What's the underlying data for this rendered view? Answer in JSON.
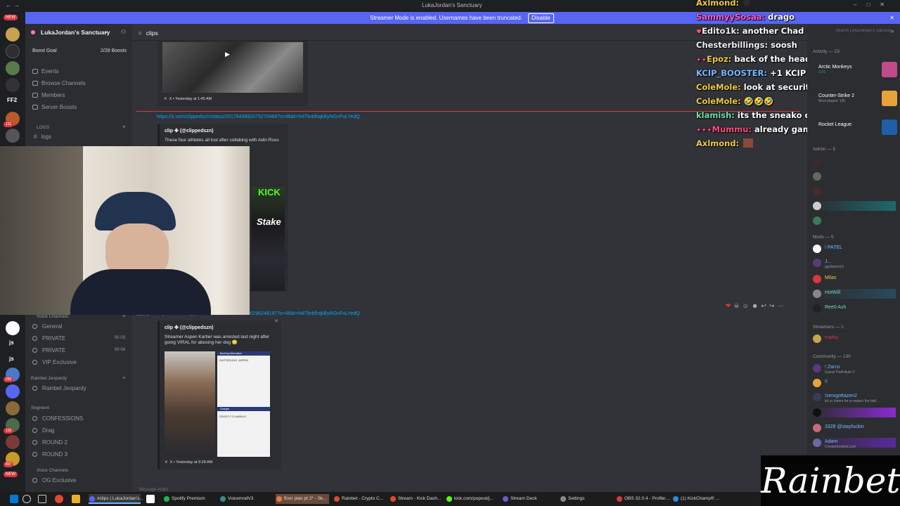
{
  "window": {
    "title": "LukaJordan's Sanctuary",
    "nav_back": "←",
    "nav_forward": "→"
  },
  "banner": {
    "text": "Streamer Mode is enabled. Usernames have been truncated.",
    "button": "Disable"
  },
  "rail": {
    "badges": [
      "NEW",
      "NEW"
    ],
    "ff2": "FF2",
    "counts": [
      "131",
      "289",
      "120",
      "897"
    ],
    "js1": "js",
    "js2": "js"
  },
  "sidebar": {
    "server_name": "LukaJordan's Sanctuary",
    "boost_goal": "Boost Goal",
    "boost_count": "2/28 Boosts",
    "nav": [
      "Events",
      "Browse Channels",
      "Members",
      "Server Boosts"
    ],
    "categories": {
      "logs": "LOGS",
      "voice": "Voice Channels",
      "rainbet": "Rainbet Jeopardy",
      "segment": "Segment",
      "voice2": "Voice Channels"
    },
    "channels_top": [
      "logs"
    ],
    "voice_channels": [
      {
        "name": "General",
        "count_a": "",
        "count_b": ""
      },
      {
        "name": "PRIVATE",
        "count_a": "00",
        "count_b": "03"
      },
      {
        "name": "PRIVATE",
        "count_a": "00",
        "count_b": "04"
      },
      {
        "name": "VIP Exclusive",
        "count_a": "",
        "count_b": ""
      }
    ],
    "rainbet_channels": [
      "Rainbet Jeopardy"
    ],
    "segment_channels": [
      "CONFESSIONS",
      "Drag",
      "ROUND 2",
      "ROUND 3"
    ],
    "voice2_channels": [
      "OG Exclusive"
    ]
  },
  "header": {
    "channel": "clips",
    "search_placeholder": "Search LukaJordan's Sanctuary"
  },
  "messages": [
    {
      "footer": "X • Yesterday at 1:45 AM"
    },
    {
      "link": "https://x.com/clippedszn/status/2017843892075270486?s=46&t=N4TbrblhqkByNGnFoLYedQ",
      "author": "clip ✤ (@clippedszn)",
      "desc": "These four athletes all lost after collabing with Adin Ross"
    },
    {
      "time": "3:35 PM",
      "link": "https://x.com/clippedszn/status/2017856536296248197?s=46&t=N4TbrblhqkByNGnFoLYedQ",
      "author": "clip ✤ (@clippedszn)",
      "desc": "Streamer Aspen Kartier was arrested last night after going VIRAL for abusing her dog 😳",
      "footer": "X • Yesterday at 9:28 AM",
      "mugshot_lines": [
        "Booking Information",
        "EASTERLING, ASPEN",
        "Charges",
        "CRUELTY TO ANIMALS"
      ]
    }
  ],
  "embed_logos": [
    "KICK",
    "Stake"
  ],
  "composer_placeholder": "Message #clips",
  "chat": [
    {
      "user": "Axlmond:",
      "msg": "",
      "color": "#f0c94a"
    },
    {
      "user": "SammyySosaa:",
      "msg": "drago",
      "color": "#ff5bd1"
    },
    {
      "user": "Edito1k:",
      "msg": "another Chad I think",
      "color": "#f0f0f0"
    },
    {
      "user": "Chesterbillings:",
      "msg": "soosh",
      "color": "#f0f0f0"
    },
    {
      "user": "Epoz:",
      "msg": "back of the head oh nah",
      "color": "#f0c94a"
    },
    {
      "user": "KCIP_BOOSTER:",
      "msg": "+1 KCIP",
      "color": "#7ab7ff"
    },
    {
      "user": "ColeMole:",
      "msg": "look at security",
      "color": "#f0c94a"
    },
    {
      "user": "ColeMole:",
      "msg": "🤣🤣🤣",
      "color": "#f0c94a"
    },
    {
      "user": "klamish:",
      "msg": "its the sneako chad",
      "color": "#6fe0a8"
    },
    {
      "user": "Mummu:",
      "msg": "already gambling??",
      "color": "#ff4d7a"
    },
    {
      "user": "Axlmond:",
      "msg": "",
      "color": "#f0c94a"
    }
  ],
  "members": {
    "activity_header": "Activity — 23",
    "activity": [
      {
        "name": "Arctic Monkeys",
        "sub": "2:29",
        "color": "#ffffff"
      },
      {
        "name": "Counter-Strike 2",
        "sub": "Most played: 12h",
        "color": "#ffffff"
      },
      {
        "name": "Rocket League",
        "sub": "",
        "color": "#ffffff"
      }
    ],
    "admin_header": "Admin — 5",
    "mods_header": "Mods — 5",
    "mods": [
      {
        "name": "! PATEL",
        "sub": "",
        "color": "#7ab7ff"
      },
      {
        "name": "J...",
        "sub": "gg/district10",
        "color": "#7ab7ff"
      },
      {
        "name": "Milas",
        "sub": "",
        "color": "#f0c94a"
      },
      {
        "name": "HotWill",
        "sub": "",
        "color": "#6fe0a8"
      },
      {
        "name": "Ree0 Ash",
        "sub": "",
        "color": "#6fe0a8"
      }
    ],
    "streamers_header": "Streamers — 1",
    "streamers": [
      {
        "name": "marky",
        "sub": "",
        "color": "#da373c"
      }
    ],
    "community_header": "Community — 130",
    "community": [
      {
        "name": "! Zarco",
        "sub": "Grand Theft Auto V",
        "color": "#7ab7ff"
      },
      {
        "name": "!!",
        "sub": "",
        "color": "#7ab7ff"
      },
      {
        "name": "!zerxgottazen2",
        "sub": "let ur haters be ur waters the tabl...",
        "color": "#7ab7ff"
      },
      {
        "name": "3328 @stayfuckin",
        "sub": "",
        "color": "#7ab7ff"
      },
      {
        "name": "Adam",
        "sub": "Creatortoolslist.com",
        "color": "#7ab7ff"
      }
    ]
  },
  "rainbet_logo": "Rainbet",
  "taskbar": [
    {
      "label": "#clips | LukaJordan's..."
    },
    {
      "label": "Spotify Premium"
    },
    {
      "label": "VoicemodV3"
    },
    {
      "label": "floor plan pt 2* - Sk..."
    },
    {
      "label": "Rainbet - Crypto C..."
    },
    {
      "label": "Stream - Kick Dash..."
    },
    {
      "label": "kick.com/popout/j..."
    },
    {
      "label": "Stream Deck"
    },
    {
      "label": "Settings"
    },
    {
      "label": "OBS 32.0.4 - Profile:..."
    },
    {
      "label": "(1) KickChamp® ..."
    }
  ],
  "colors": {
    "accent": "#5865f2",
    "link": "#00a8fc",
    "mention_line": "#da373c",
    "online": "#23a55a"
  }
}
